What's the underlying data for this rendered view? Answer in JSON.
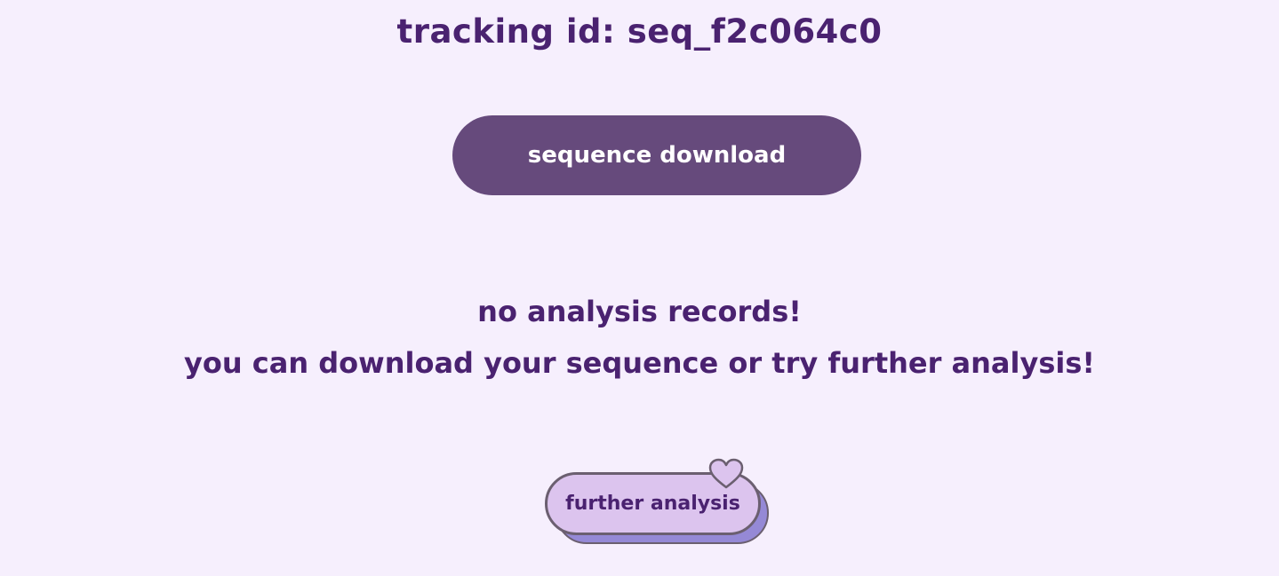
{
  "tracking": {
    "text": "tracking id: seq_f2c064c0"
  },
  "download_button": {
    "label": "sequence download"
  },
  "message": {
    "line1": "no analysis records!",
    "line2": "you can download your sequence or try further analysis!"
  },
  "further_button": {
    "label": "further analysis",
    "icon": "heart-icon"
  },
  "colors": {
    "background": "#f6effd",
    "text": "#4a2270",
    "download_button": "#664a7c",
    "further_button": "#dcc4ee",
    "further_shadow": "#9589d6"
  }
}
